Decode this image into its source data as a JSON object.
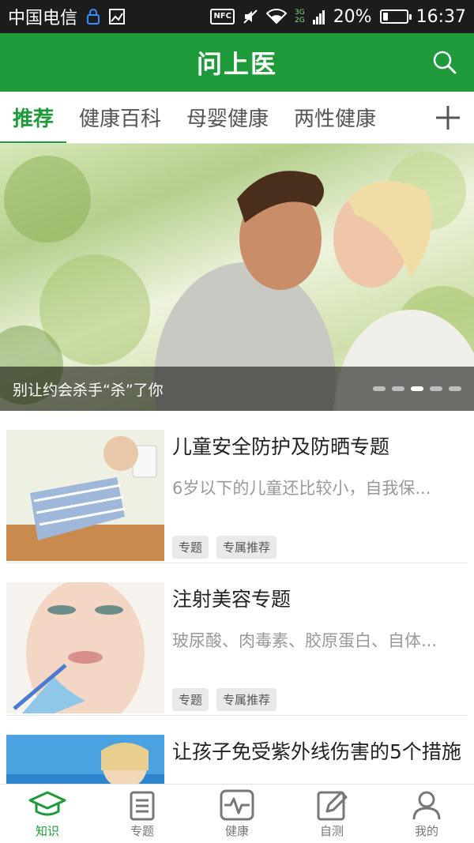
{
  "status_bar": {
    "carrier": "中国电信",
    "nfc": "NFC",
    "network_top": "3G",
    "network_bottom": "2G",
    "battery_percent": "20%",
    "battery_level": 0.2,
    "time": "16:37"
  },
  "app_bar": {
    "title": "问上医",
    "search_icon": "search-icon",
    "color": "#1e9a3b"
  },
  "tabs": [
    {
      "label": "推荐",
      "active": true
    },
    {
      "label": "健康百科",
      "active": false
    },
    {
      "label": "母婴健康",
      "active": false
    },
    {
      "label": "两性健康",
      "active": false
    }
  ],
  "banner": {
    "caption": "别让约会杀手“杀”了你",
    "dot_count": 5,
    "active_dot": 3
  },
  "articles": [
    {
      "title": "儿童安全防护及防晒专题",
      "description": "6岁以下的儿童还比较小，自我保...",
      "tags": [
        "专题",
        "专属推荐"
      ]
    },
    {
      "title": "注射美容专题",
      "description": "玻尿酸、肉毒素、胶原蛋白、自体...",
      "tags": [
        "专题",
        "专属推荐"
      ]
    },
    {
      "title": "让孩子免受紫外线伤害的5个措施",
      "description": "",
      "tags": []
    }
  ],
  "bottom_nav": [
    {
      "label": "知识",
      "icon": "graduation-cap-icon",
      "active": true
    },
    {
      "label": "专题",
      "icon": "clipboard-icon",
      "active": false
    },
    {
      "label": "健康",
      "icon": "pulse-icon",
      "active": false
    },
    {
      "label": "自测",
      "icon": "edit-icon",
      "active": false
    },
    {
      "label": "我的",
      "icon": "user-icon",
      "active": false
    }
  ]
}
